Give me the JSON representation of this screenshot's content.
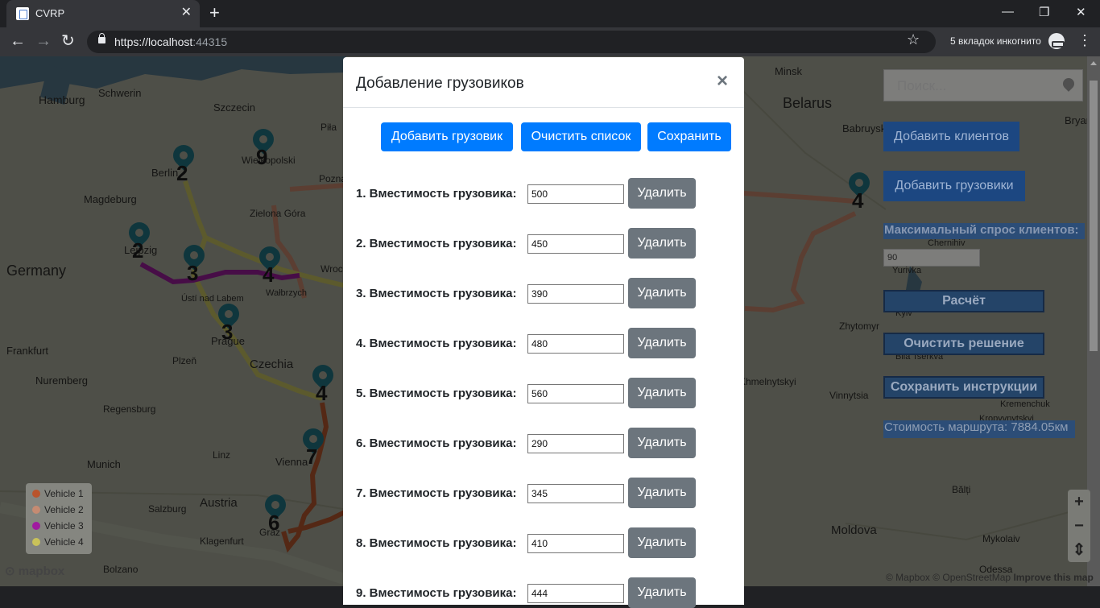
{
  "browser": {
    "tab_title": "CVRP",
    "url_host": "https://localhost",
    "url_port": ":44315",
    "incognito_text": "5 вкладок инкогнито"
  },
  "map": {
    "labels": [
      {
        "text": "Hamburg",
        "size": 14
      },
      {
        "text": "Schwerin",
        "size": 13
      },
      {
        "text": "Szczecin",
        "size": 13
      },
      {
        "text": "Minsk",
        "size": 13
      },
      {
        "text": "Belarus",
        "size": 18
      },
      {
        "text": "Babruysk",
        "size": 13
      },
      {
        "text": "Bryansk",
        "size": 13
      },
      {
        "text": "Piła",
        "size": 12
      },
      {
        "text": "Berlin",
        "size": 13
      },
      {
        "text": "Wielkopolski",
        "size": 12
      },
      {
        "text": "Poznań",
        "size": 12
      },
      {
        "text": "Magdeburg",
        "size": 13
      },
      {
        "text": "Zielona Góra",
        "size": 12
      },
      {
        "text": "Leipzig",
        "size": 13
      },
      {
        "text": "Germany",
        "size": 18
      },
      {
        "text": "Wrocław",
        "size": 12
      },
      {
        "text": "Ústí nad Labem",
        "size": 11
      },
      {
        "text": "Wałbrzych",
        "size": 11
      },
      {
        "text": "Prague",
        "size": 13
      },
      {
        "text": "Frankfurt",
        "size": 13
      },
      {
        "text": "Czechia",
        "size": 15
      },
      {
        "text": "Plzeň",
        "size": 12
      },
      {
        "text": "Nuremberg",
        "size": 13
      },
      {
        "text": "Regensburg",
        "size": 12
      },
      {
        "text": "Linz",
        "size": 12
      },
      {
        "text": "Vienna",
        "size": 13
      },
      {
        "text": "Munich",
        "size": 13
      },
      {
        "text": "Salzburg",
        "size": 12
      },
      {
        "text": "Austria",
        "size": 15
      },
      {
        "text": "Graz",
        "size": 12
      },
      {
        "text": "Klagenfurt",
        "size": 12
      },
      {
        "text": "Bolzano",
        "size": 12
      },
      {
        "text": "Chernihiv",
        "size": 11
      },
      {
        "text": "Yurivka",
        "size": 11
      },
      {
        "text": "Kyiv",
        "size": 11
      },
      {
        "text": "Zhytomyr",
        "size": 12
      },
      {
        "text": "Bila Tserkva",
        "size": 11
      },
      {
        "text": "Khmelnytskyi",
        "size": 12
      },
      {
        "text": "Vinnytsia",
        "size": 12
      },
      {
        "text": "Kremenchuk",
        "size": 11
      },
      {
        "text": "Kropyvnytskyi",
        "size": 11
      },
      {
        "text": "Bălți",
        "size": 12
      },
      {
        "text": "Moldova",
        "size": 15
      },
      {
        "text": "Mykolaiv",
        "size": 12
      },
      {
        "text": "Odessa",
        "size": 12
      }
    ],
    "markers": [
      "9",
      "2",
      "2",
      "3",
      "4",
      "3",
      "4",
      "7",
      "6",
      "4"
    ],
    "legend": [
      {
        "label": "Vehicle 1",
        "color": "#b9542c"
      },
      {
        "label": "Vehicle 2",
        "color": "#c58b72"
      },
      {
        "label": "Vehicle 3",
        "color": "#a01aa0"
      },
      {
        "label": "Vehicle 4",
        "color": "#c9c25a"
      }
    ],
    "logo": "mapbox",
    "attribution_links": "© Mapbox © OpenStreetMap",
    "attribution_improve": "Improve this map",
    "zoom_in": "+",
    "zoom_out": "−",
    "compass": "⇕"
  },
  "panel": {
    "search_placeholder": "Поиск...",
    "add_clients": "Добавить клиентов",
    "add_trucks": "Добавить грузовики",
    "max_demand_label": "Максимальный спрос клиентов:",
    "max_demand_value": "90",
    "calculate": "Расчёт",
    "clear_solution": "Очистить решение",
    "save_instructions": "Сохранить инструкции",
    "route_cost": "Стоимость маршрута: 7884.05км"
  },
  "modal": {
    "title": "Добавление грузовиков",
    "close": "×",
    "add_truck": "Добавить грузовик",
    "clear_list": "Очистить список",
    "save": "Сохранить",
    "delete_label": "Удалить",
    "trucks": [
      {
        "label": "1. Вместимость грузовика:",
        "capacity": "500"
      },
      {
        "label": "2. Вместимость грузовика:",
        "capacity": "450"
      },
      {
        "label": "3. Вместимость грузовика:",
        "capacity": "390"
      },
      {
        "label": "4. Вместимость грузовика:",
        "capacity": "480"
      },
      {
        "label": "5. Вместимость грузовика:",
        "capacity": "560"
      },
      {
        "label": "6. Вместимость грузовика:",
        "capacity": "290"
      },
      {
        "label": "7. Вместимость грузовика:",
        "capacity": "345"
      },
      {
        "label": "8. Вместимость грузовика:",
        "capacity": "410"
      },
      {
        "label": "9. Вместимость грузовика:",
        "capacity": "444"
      }
    ]
  }
}
